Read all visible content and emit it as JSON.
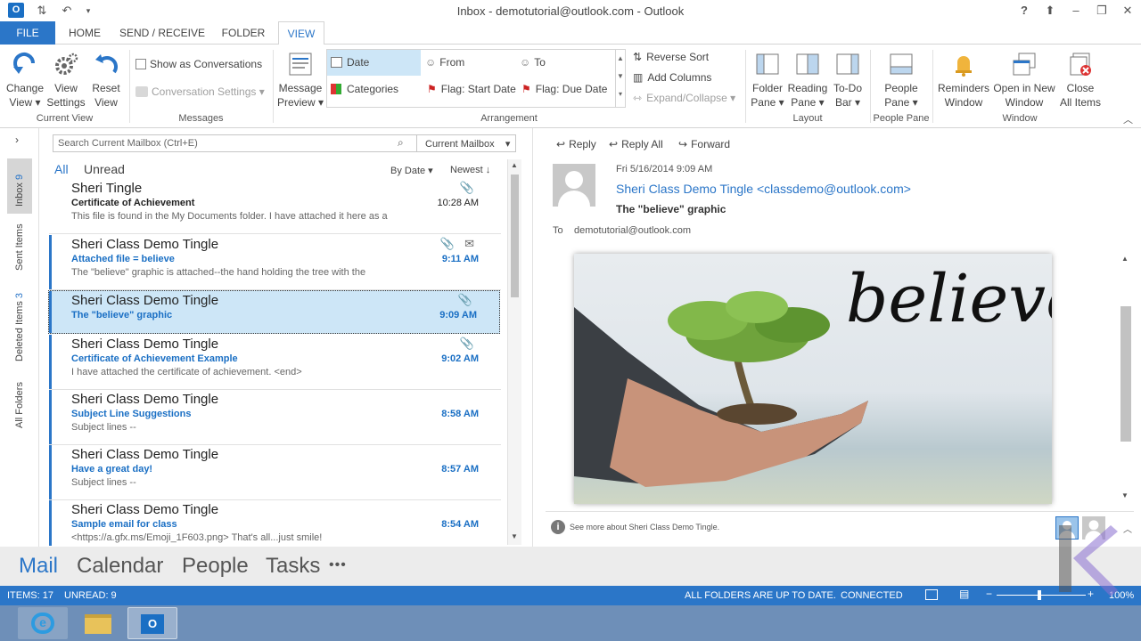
{
  "window": {
    "title": "Inbox - demotutorial@outlook.com - Outlook",
    "help": "?"
  },
  "tabs": [
    {
      "label": "FILE"
    },
    {
      "label": "HOME"
    },
    {
      "label": "SEND / RECEIVE"
    },
    {
      "label": "FOLDER"
    },
    {
      "label": "VIEW"
    }
  ],
  "ribbon": {
    "change_view": {
      "line1": "Change",
      "line2": "View ▾"
    },
    "view_settings": {
      "line1": "View",
      "line2": "Settings"
    },
    "reset_view": {
      "line1": "Reset",
      "line2": "View"
    },
    "group_current_view": "Current View",
    "show_conversations": "Show as Conversations",
    "conversation_settings": "Conversation Settings ▾",
    "group_messages": "Messages",
    "message_preview": {
      "line1": "Message",
      "line2": "Preview ▾"
    },
    "arr_date": "Date",
    "arr_from": "From",
    "arr_to": "To",
    "arr_categories": "Categories",
    "arr_flag_start": "Flag: Start Date",
    "arr_flag_due": "Flag: Due Date",
    "reverse_sort": "Reverse Sort",
    "add_columns": "Add Columns",
    "expand_collapse": "Expand/Collapse ▾",
    "group_arrangement": "Arrangement",
    "folder_pane": {
      "line1": "Folder",
      "line2": "Pane ▾"
    },
    "reading_pane": {
      "line1": "Reading",
      "line2": "Pane ▾"
    },
    "todo_bar": {
      "line1": "To-Do",
      "line2": "Bar ▾"
    },
    "group_layout": "Layout",
    "people_pane": {
      "line1": "People",
      "line2": "Pane ▾"
    },
    "group_people_pane": "People Pane",
    "reminders_window": {
      "line1": "Reminders",
      "line2": "Window"
    },
    "open_new_window": {
      "line1": "Open in New",
      "line2": "Window"
    },
    "close_all_items": {
      "line1": "Close",
      "line2": "All Items"
    },
    "group_window": "Window"
  },
  "leftnav": {
    "inbox": "Inbox",
    "inbox_count": "9",
    "sent": "Sent Items",
    "deleted": "Deleted Items",
    "deleted_count": "3",
    "all_folders": "All Folders"
  },
  "search": {
    "placeholder": "Search Current Mailbox (Ctrl+E)",
    "scope": "Current Mailbox"
  },
  "filters": {
    "all": "All",
    "unread": "Unread",
    "by_date": "By Date ▾",
    "newest": "Newest ↓"
  },
  "messages": [
    {
      "sender": "Sheri Tingle",
      "subject": "Certificate of Achievement",
      "preview": "This file is found in the My Documents folder.  I have attached it here as a",
      "time": "10:28 AM"
    },
    {
      "sender": "Sheri Class Demo Tingle",
      "subject": "Attached file = believe",
      "preview": "The \"believe\" graphic is attached--the hand holding the tree with the",
      "time": "9:11 AM"
    },
    {
      "sender": "Sheri Class Demo Tingle",
      "subject": "The \"believe\" graphic",
      "preview": "",
      "time": "9:09 AM"
    },
    {
      "sender": "Sheri Class Demo Tingle",
      "subject": "Certificate of Achievement Example",
      "preview": "I have attached the certificate of achievement.  <end>",
      "time": "9:02 AM"
    },
    {
      "sender": "Sheri Class Demo Tingle",
      "subject": "Subject Line Suggestions",
      "preview": "Subject lines --",
      "time": "8:58 AM"
    },
    {
      "sender": "Sheri Class Demo Tingle",
      "subject": "Have a great day!",
      "preview": "Subject lines --",
      "time": "8:57 AM"
    },
    {
      "sender": "Sheri Class Demo Tingle",
      "subject": "Sample email for class",
      "preview": "<https://a.gfx.ms/Emoji_1F603.png>  That's all...just smile!",
      "time": "8:54 AM"
    }
  ],
  "reading": {
    "reply": "Reply",
    "reply_all": "Reply All",
    "forward": "Forward",
    "date": "Fri 5/16/2014 9:09 AM",
    "from": "Sheri Class Demo Tingle <classdemo@outlook.com>",
    "subject": "The \"believe\" graphic",
    "to_label": "To",
    "to": "demotutorial@outlook.com",
    "image_word": "believe",
    "see_more": "See more about Sheri Class Demo Tingle."
  },
  "bottomnav": {
    "mail": "Mail",
    "calendar": "Calendar",
    "people": "People",
    "tasks": "Tasks",
    "more": "•••"
  },
  "status": {
    "items": "ITEMS: 17",
    "unread": "UNREAD: 9",
    "sync": "ALL FOLDERS ARE UP TO DATE.",
    "connected": "CONNECTED",
    "zoom": "100%"
  },
  "colors": {
    "accent": "#2b76c8",
    "selected": "#cde6f7"
  }
}
